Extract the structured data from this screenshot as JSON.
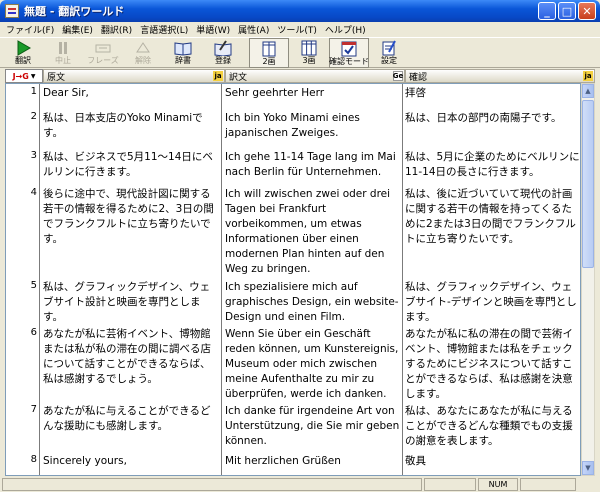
{
  "window": {
    "title": "無題 - 翻訳ワールド"
  },
  "menu": [
    "ファイル(F)",
    "編集(E)",
    "翻訳(R)",
    "言語選択(L)",
    "単語(W)",
    "属性(A)",
    "ツール(T)",
    "ヘルプ(H)"
  ],
  "toolbar": {
    "translate": "翻訳",
    "stop": "中止",
    "phrase": "フレーズ",
    "release": "解除",
    "dictionary": "辞書",
    "register": "登録",
    "two_pane": "2画",
    "three_pane": "3画",
    "confirm_mode": "確認モード",
    "settings": "設定"
  },
  "columns": {
    "selector": "J→G",
    "source": "原文",
    "source_badge": "ja",
    "target": "訳文",
    "target_badge": "Ge",
    "review": "確認",
    "review_badge": "ja"
  },
  "rows": [
    {
      "n": "1",
      "src": "Dear Sir,",
      "tgt": "Sehr geehrter Herr",
      "rev": "拝啓"
    },
    {
      "n": "2",
      "src": "私は、日本支店のYoko Minamiです。",
      "tgt": "Ich bin Yoko Minami eines japanischen Zweiges.",
      "rev": "私は、日本の部門の南陽子です。"
    },
    {
      "n": "3",
      "src": "私は、ビジネスで5月11～14日にベルリンに行きます。",
      "tgt": "Ich gehe 11-14 Tage lang im Mai nach Berlin für Unternehmen.",
      "rev": "私は、5月に企業のためにベルリンに11-14日の長さに行きます。"
    },
    {
      "n": "4",
      "src": "後らに途中で、現代設計図に関する若干の情報を得るために2、3日の間でフランクフルトに立ち寄りたいです。",
      "tgt": "Ich will zwischen zwei oder drei Tagen bei Frankfurt vorbeikommen, um etwas Informationen über einen modernen Plan hinten auf den Weg zu bringen.",
      "rev": "私は、後に近づいていて現代の計画に関する若干の情報を持ってくるために2または3日の間でフランクフルトに立ち寄りたいです。"
    },
    {
      "n": "5",
      "src": "私は、グラフィックデザイン、ウェブサイト設計と映画を専門とします。",
      "tgt": "Ich spezialisiere mich auf graphisches Design, ein website-Design und einen Film.",
      "rev": "私は、グラフィックデザイン、ウェブサイト-デザインと映画を専門とします。"
    },
    {
      "n": "6",
      "src": "あなたが私に芸術イベント、博物館または私が私の滞在の間に調べる店について話すことができるならば、私は感謝するでしょう。",
      "tgt": "Wenn Sie über ein Geschäft reden können, um Kunstereignis, Museum oder mich zwischen meine Aufenthalte zu mir zu überprüfen, werde ich danken.",
      "rev": "あなたが私に私の滞在の間で芸術イベント、博物館または私をチェックするためにビジネスについて話すことができるならば、私は感謝を決意します。"
    },
    {
      "n": "7",
      "src": "あなたが私に与えることができるどんな援助にも感謝します。",
      "tgt": "Ich danke für irgendeine Art von Unterstützung, die Sie mir geben können.",
      "rev": "私は、あなたにあなたが私に与えることができるどんな種類でもの支援の謝意を表します。"
    },
    {
      "n": "8",
      "src": "Sincerely yours,",
      "tgt": "Mit herzlichen Grüßen",
      "rev": "敬具"
    }
  ],
  "status": {
    "num": "NUM"
  },
  "colors": {
    "titlebar": "#0a56d8",
    "chrome": "#ece9d8",
    "accent": "#c00000"
  }
}
